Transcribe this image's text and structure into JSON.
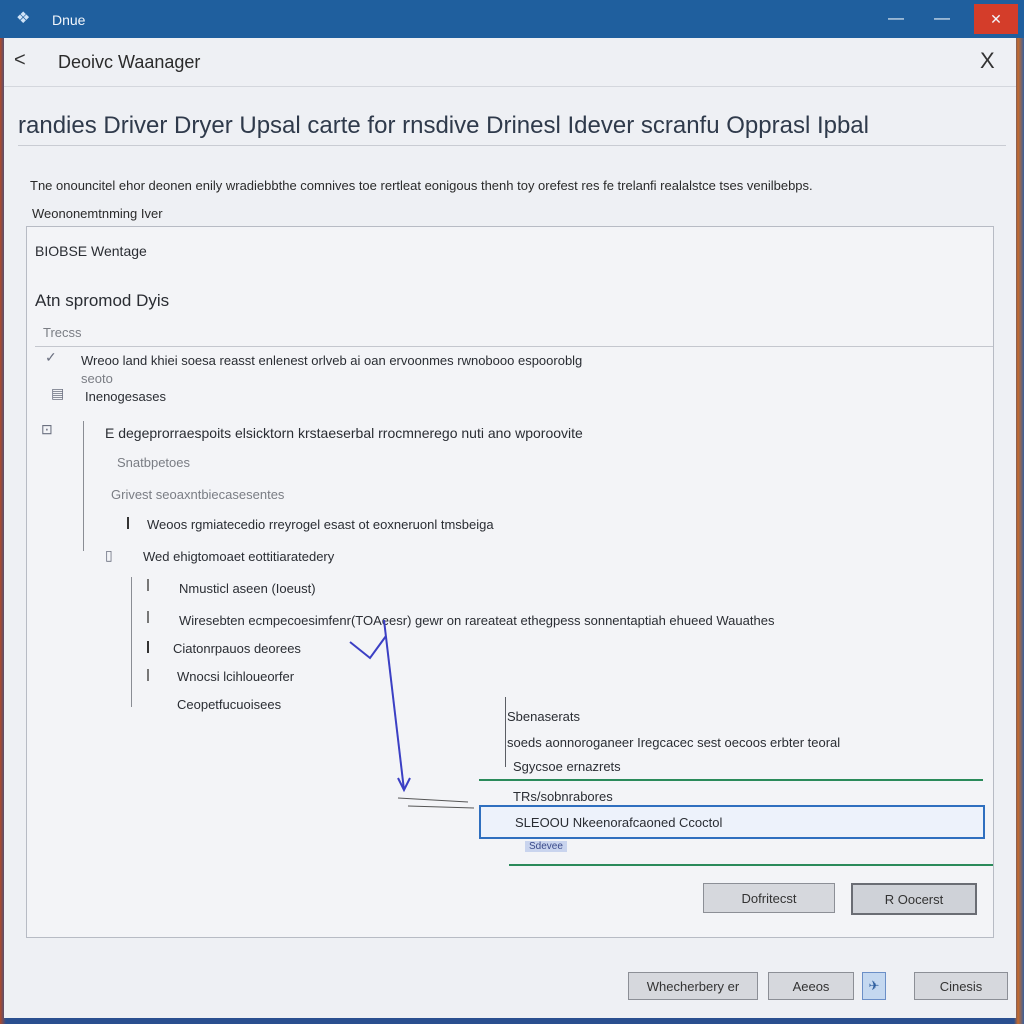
{
  "titlebar": {
    "app_title": "Dnue",
    "minimize": "—",
    "maximize": "—",
    "close": "✕"
  },
  "header": {
    "back": "<",
    "title": "Deoivc Waanager",
    "close": "X"
  },
  "dialog": {
    "heading": "randies Driver  Dryer  Upsal carte for rnsdive  Drinesl  Idever scranfu Opprasl Ipbal",
    "description": "Tne onouncitel ehor deonen enily wradiebbthe comnives toe rertleat eonigous thenh toy orefest res fe trelanfi realalstce tses venilbebps.",
    "subtext": "Weononemtnming Iver"
  },
  "panel": {
    "section_label": "BIOBSE Wentage",
    "group_title": "Atn spromod Dyis",
    "tag": "Trecss",
    "line_1": "Wreoo land khiei soesa reasst enlenest orlveb ai oan ervoonmes rwnobooo espooroblg",
    "line_1_sub": "seoto",
    "line_2": "Inenogesases",
    "line_3": "E degeprorraespoits elsicktorn krstaeserbal rrocmnerego nuti ano wporoovite",
    "line_4": "Snatbpetoes",
    "line_5": "Grivest seoaxntbiecasesentes",
    "line_6": "Weoos rgmiatecedio rreyrogel esast ot eoxneruonl tmsbeiga",
    "line_7": "Wed ehigtomoaet eottitiaratedery",
    "line_8": "Nmusticl aseen (Ioeust)",
    "line_9": "Wiresebten ecmpecoesimfenr(TOAeesr) gewr on rareateat ethegpess sonnentaptiah ehueed Wauathes",
    "line_10": "Ciatonrpauos deorees",
    "line_11": "Wnocsi lcihloueorfer",
    "line_12": "Ceopetfucuoisees",
    "popover_title": "Sbenaserats",
    "popover_line_1": "soeds aonnoroganeer Iregcacec sest oecoos erbter teoral",
    "popover_line_2": "Sgycsoe ernazrets",
    "popover_line_3": "TRs/sobnrabores",
    "popover_selected": "SLEOOU Nkeenorafcaoned Ccoctol",
    "popover_hint": "Sdevee"
  },
  "buttons": {
    "secondary": "Dofritecst",
    "primary": "R Oocerst"
  },
  "footer": {
    "btn_1": "Whecherbery er",
    "btn_2": "Aeeos",
    "btn_4": "Cinesis"
  },
  "icons": {
    "app": "app-logo-icon",
    "back": "chevron-left-icon",
    "close": "close-icon",
    "check": "check-icon",
    "list": "list-icon",
    "pin": "device-icon"
  },
  "colors": {
    "titlebar": "#1f5f9e",
    "close_button": "#d43d2a",
    "selection": "#2f6fbf",
    "accent_green": "#2a8a5a",
    "arrow": "#3b3fc4"
  }
}
